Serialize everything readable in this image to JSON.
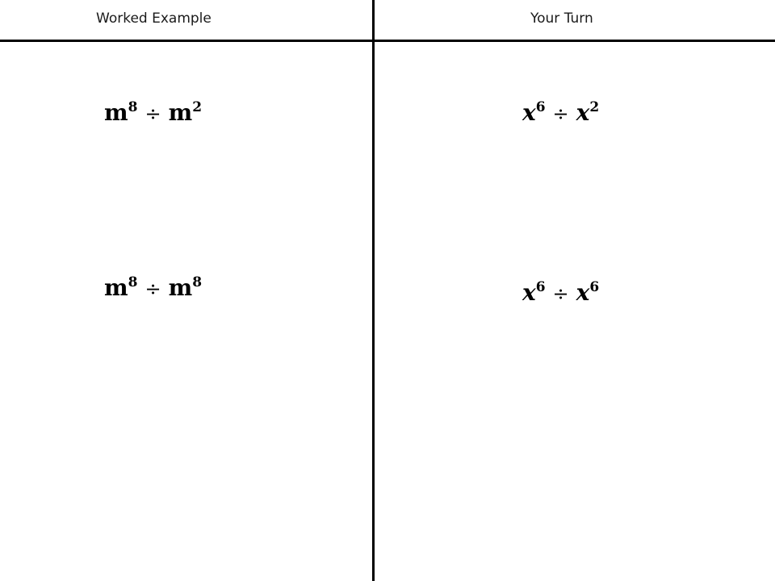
{
  "headers": {
    "left": "Worked Example",
    "right": "Your Turn"
  },
  "worked_example": [
    {
      "base1": "m",
      "exp1": "8",
      "operator": "÷",
      "base2": "m",
      "exp2": "2"
    },
    {
      "base1": "m",
      "exp1": "8",
      "operator": "÷",
      "base2": "m",
      "exp2": "8"
    }
  ],
  "your_turn": [
    {
      "base1": "x",
      "exp1": "6",
      "operator": "÷",
      "base2": "x",
      "exp2": "2"
    },
    {
      "base1": "x",
      "exp1": "6",
      "operator": "÷",
      "base2": "x",
      "exp2": "6"
    }
  ],
  "colors": {
    "background": "#ffffff",
    "lines": "#000000",
    "text": "#000000"
  }
}
